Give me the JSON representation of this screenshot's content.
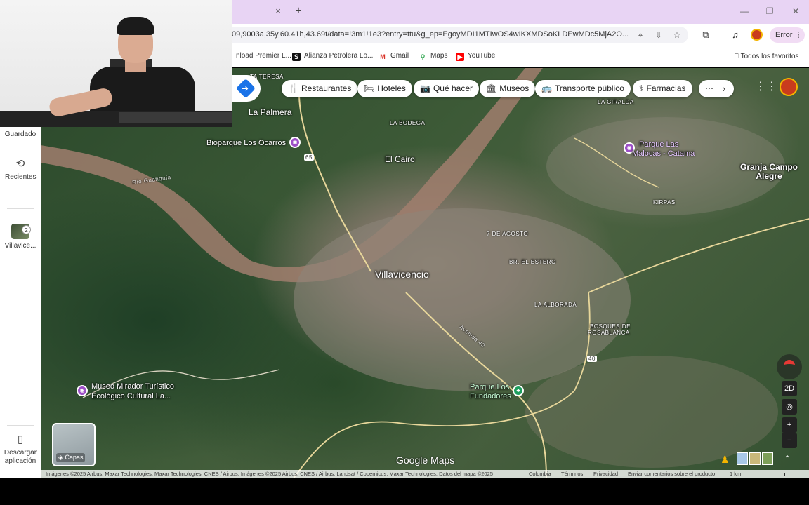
{
  "browser": {
    "url": "09,9003a,35y,60.41h,43.69t/data=!3m1!1e3?entry=ttu&g_ep=EgoyMDI1MTIwOS4wIKXMDSoKLDEwMDc5MjA2O...",
    "error_label": "Error",
    "tab_close": "×",
    "tab_new": "+",
    "bookmarks": [
      "nload Premier L...",
      "Alianza Petrolera Lo...",
      "Gmail",
      "Maps",
      "YouTube"
    ],
    "all_favorites": "Todos los favoritos",
    "colors": {
      "tab_bg": "#e8d4f4",
      "accent": "#1a73e8"
    }
  },
  "sidebar": {
    "saved": "Guardado",
    "recents": "Recientes",
    "recent_place": "Villavice...",
    "recent_badge": "2",
    "download_app": "Descargar aplicación"
  },
  "chips": [
    "Restaurantes",
    "Hoteles",
    "Qué hacer",
    "Museos",
    "Transporte público",
    "Farmacias"
  ],
  "chip_icons": [
    "fork-knife-icon",
    "bed-icon",
    "camera-icon",
    "museum-icon",
    "bus-icon",
    "pharmacy-icon"
  ],
  "map": {
    "city": "Villavicencio",
    "places": [
      "La Palmera",
      "El Cairo",
      "Granja Campo Alegre"
    ],
    "small_places": [
      "TA TERESA",
      "LA BODEGA",
      "LA GIRALDA",
      "KIRPAS",
      "7 DE AGOSTO",
      "BR. EL ESTERO",
      "LA ALBORADA",
      "BOSQUES DE",
      "ROSABLANCA"
    ],
    "river": "Río Guatiquía",
    "road_shields": [
      "65",
      "40"
    ],
    "pois": [
      {
        "line1": "Bioparque Los Ocarros",
        "line2": "",
        "type": "museum"
      },
      {
        "line1": "Parque Las",
        "line2": "Malocas - Catama",
        "type": "museum"
      },
      {
        "line1": "Museo Mirador Turístico",
        "line2": "Ecológico Cultural La...",
        "type": "museum"
      },
      {
        "line1": "Parque Los",
        "line2": "Fundadores",
        "type": "park"
      }
    ],
    "street_label": "Avenida 40"
  },
  "controls": {
    "layers": "Capas",
    "view_2d": "2D",
    "zoom_in": "+",
    "zoom_out": "−",
    "logo": "Google Maps"
  },
  "footer": {
    "attribution": "Imágenes ©2025 Airbus, Maxar Technologies, Maxar Technologies, CNES / Airbus, Imágenes ©2025 Airbus, CNES / Airbus, Landsat / Copernicus, Maxar Technologies, Datos del mapa ©2025",
    "links": [
      "Colombia",
      "Términos",
      "Privacidad",
      "Enviar comentarios sobre el producto"
    ],
    "scale": "1 km"
  }
}
